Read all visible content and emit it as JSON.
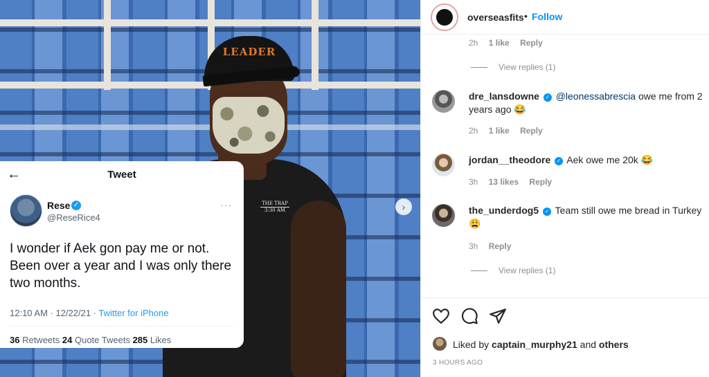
{
  "tweet": {
    "title": "Tweet",
    "name": "Rese",
    "handle": "@ReseRice4",
    "more": "···",
    "text": "I wonder if Aek gon pay me or not. Been over a year and I was only there two months.",
    "timestamp": "12:10 AM · 12/22/21 · ",
    "source": "Twitter for iPhone",
    "retweets": "36",
    "retweets_label": " Retweets ",
    "quotes": "24",
    "quotes_label": " Quote Tweets ",
    "likes": "285",
    "likes_label": " Likes"
  },
  "photo": {
    "cap_text": "LEADER",
    "shirt_line1": "THE TRAP",
    "shirt_line2": "3:30 AM"
  },
  "post": {
    "username": "overseasfits",
    "dot": "•",
    "follow": "Follow"
  },
  "comments": {
    "top_meta": {
      "time": "2h",
      "likes": "1 like",
      "reply": "Reply"
    },
    "view_replies_1": "View replies (1)",
    "items": [
      {
        "user": "dre_lansdowne",
        "mention": "@leonessabrescia",
        "text": " owe me from 2 years ago 😂",
        "time": "2h",
        "likes": "1 like",
        "reply": "Reply"
      },
      {
        "user": "jordan__theodore",
        "text": "Aek owe me 20k 😂",
        "time": "3h",
        "likes": "13 likes",
        "reply": "Reply"
      },
      {
        "user": "the_underdog5",
        "text": "Team still owe me bread in Turkey 😩",
        "time": "3h",
        "reply": "Reply"
      }
    ],
    "view_replies_2": "View replies (1)"
  },
  "footer": {
    "liked_prefix": "Liked by ",
    "liked_user": "captain_murphy21",
    "liked_and": " and ",
    "liked_others": "others",
    "time_ago": "3 HOURS AGO"
  },
  "icons": {
    "verified": "✓",
    "back": "←",
    "next": "›"
  }
}
